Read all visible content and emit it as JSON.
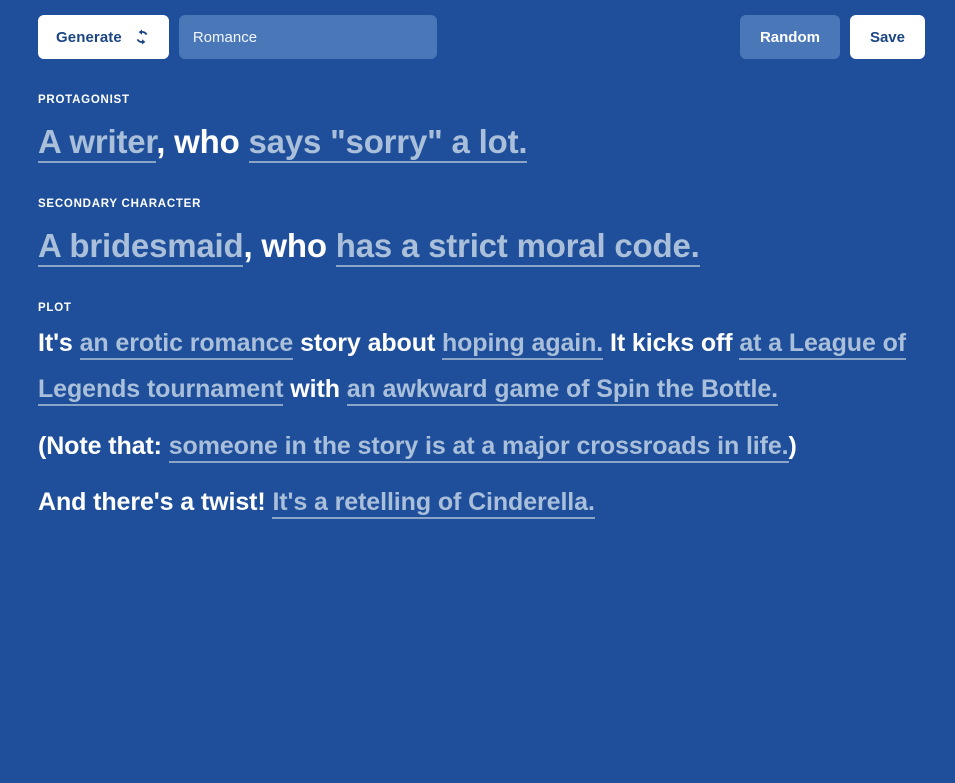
{
  "toolbar": {
    "generate_label": "Generate",
    "generate_icon": "refresh-icon",
    "genre_value": "Romance",
    "genre_placeholder": "Romance",
    "random_label": "Random",
    "save_label": "Save"
  },
  "colors": {
    "background": "#1f4f9b",
    "input_background": "#4a77b8",
    "slot_text": "#a9bfda",
    "slot_underline": "#8aa5c8",
    "fixed_text": "#ffffff",
    "button_light_text": "#1b4585"
  },
  "sections": {
    "protagonist": {
      "label": "PROTAGONIST",
      "article": "A ",
      "noun": "writer",
      "connector": ", who ",
      "trait": "says \"sorry\" a lot."
    },
    "secondary": {
      "label": "SECONDARY CHARACTER",
      "article": "A ",
      "noun": "bridesmaid",
      "connector": ", who ",
      "trait": "has a strict moral code."
    },
    "plot": {
      "label": "PLOT",
      "line1": {
        "a": "It's ",
        "genre": "an erotic romance",
        "b": " story about ",
        "theme": "hoping again.",
        "c": " It kicks off ",
        "setting": "at a League of Legends tournament",
        "d": " with ",
        "event": "an awkward game of Spin the Bottle."
      },
      "line2": {
        "a": "(Note that: ",
        "note": "someone in the story is at a major crossroads in life.",
        "b": ")"
      },
      "line3": {
        "a": "And there's a twist! ",
        "twist": "It's a retelling of Cinderella."
      }
    }
  }
}
